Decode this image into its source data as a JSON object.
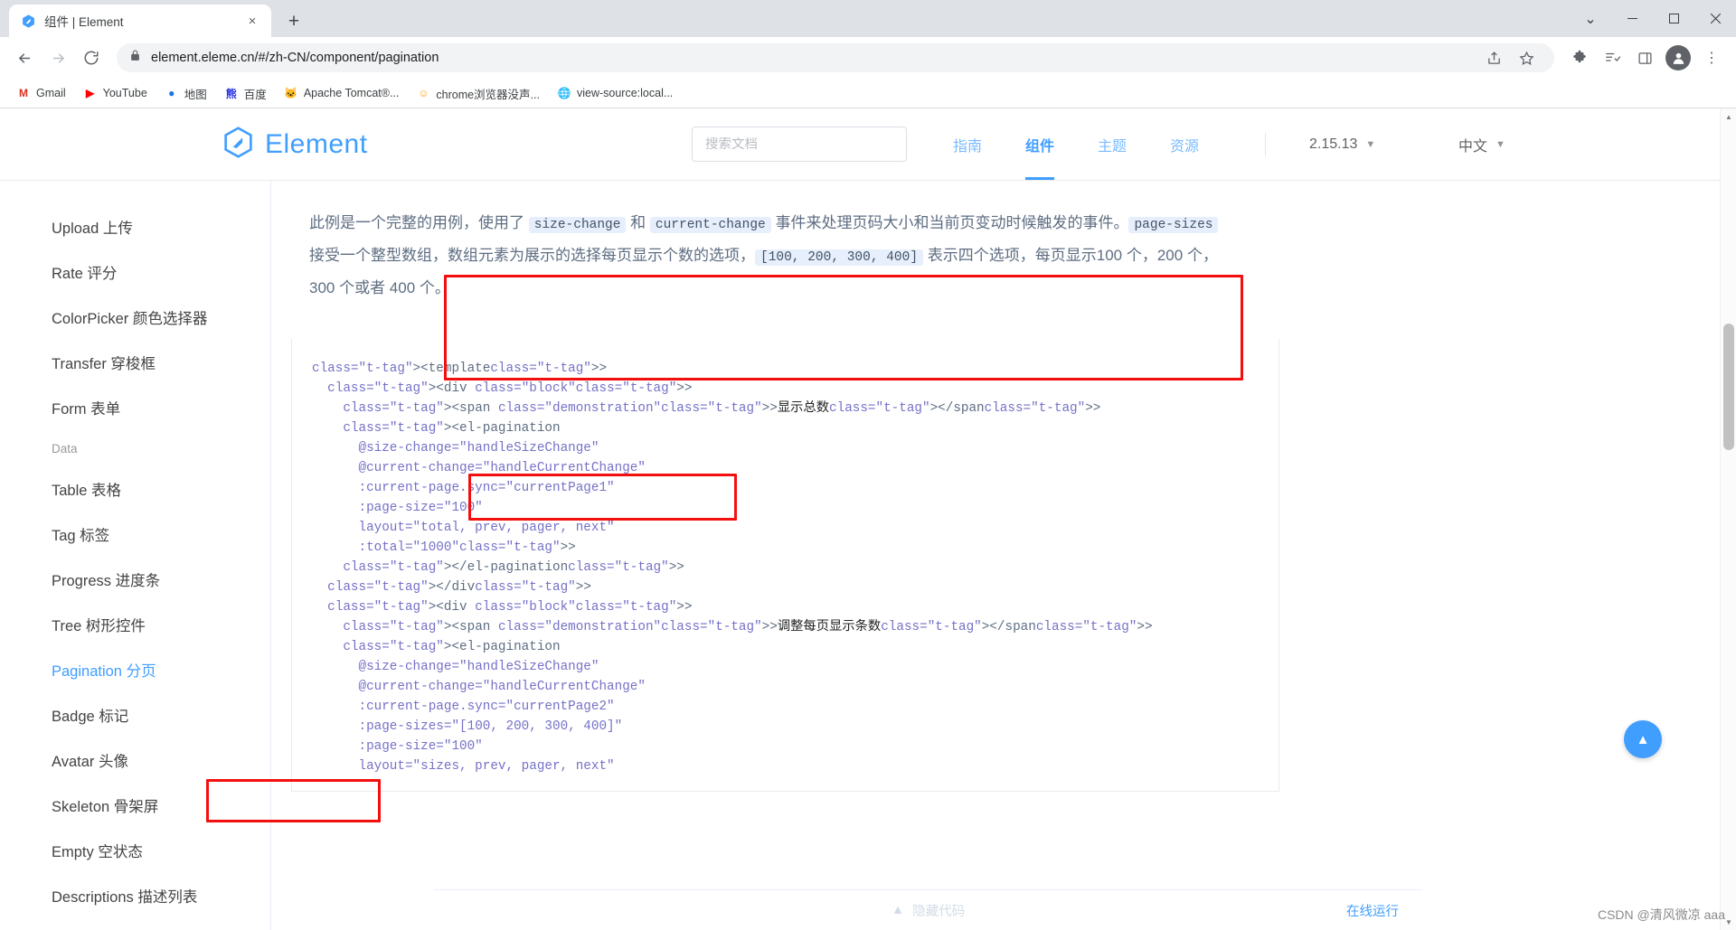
{
  "browser": {
    "tab": {
      "title": "组件 | Element",
      "favicon": "element-logo-icon",
      "close": "×"
    },
    "newtab_label": "+",
    "window_controls": {
      "minimize": "—",
      "maximize": "▢",
      "close": "✕",
      "chevron": "⌄"
    },
    "toolbar": {
      "back": "←",
      "forward": "→",
      "reload": "⟳",
      "lock": "lock-icon",
      "url": "element.eleme.cn/#/zh-CN/component/pagination",
      "share": "share-icon",
      "star": "☆",
      "extensions": "puzzle-icon",
      "readinglist": "reading-list-icon",
      "sidepanel": "side-panel-icon",
      "profile": "A",
      "menu": "⋮"
    },
    "bookmarks": [
      {
        "label": "Gmail",
        "icon": "M",
        "color": "#d93025"
      },
      {
        "label": "YouTube",
        "icon": "▶",
        "color": "#ff0000"
      },
      {
        "label": "地图",
        "icon": "●",
        "color": "#1a73e8"
      },
      {
        "label": "百度",
        "icon": "熊",
        "color": "#2932e1"
      },
      {
        "label": "Apache Tomcat®...",
        "icon": "🐱",
        "color": "#f8c471"
      },
      {
        "label": "chrome浏览器没声...",
        "icon": "☺",
        "color": "#f5a623"
      },
      {
        "label": "view-source:local...",
        "icon": "🌐",
        "color": "#5f6368"
      }
    ]
  },
  "site": {
    "brand": "Element",
    "search_placeholder": "搜索文档",
    "nav": [
      {
        "label": "指南",
        "active": false
      },
      {
        "label": "组件",
        "active": true
      },
      {
        "label": "主题",
        "active": false
      },
      {
        "label": "资源",
        "active": false
      }
    ],
    "version": "2.15.13",
    "language": "中文"
  },
  "sidebar": {
    "items": [
      {
        "label": "Upload 上传",
        "type": "item",
        "active": false
      },
      {
        "label": "Rate 评分",
        "type": "item",
        "active": false
      },
      {
        "label": "ColorPicker 颜色选择器",
        "type": "item",
        "active": false
      },
      {
        "label": "Transfer 穿梭框",
        "type": "item",
        "active": false
      },
      {
        "label": "Form 表单",
        "type": "item",
        "active": false
      },
      {
        "label": "Data",
        "type": "group"
      },
      {
        "label": "Table 表格",
        "type": "item",
        "active": false
      },
      {
        "label": "Tag 标签",
        "type": "item",
        "active": false
      },
      {
        "label": "Progress 进度条",
        "type": "item",
        "active": false
      },
      {
        "label": "Tree 树形控件",
        "type": "item",
        "active": false
      },
      {
        "label": "Pagination 分页",
        "type": "item",
        "active": true
      },
      {
        "label": "Badge 标记",
        "type": "item",
        "active": false
      },
      {
        "label": "Avatar 头像",
        "type": "item",
        "active": false
      },
      {
        "label": "Skeleton 骨架屏",
        "type": "item",
        "active": false
      },
      {
        "label": "Empty 空状态",
        "type": "item",
        "active": false
      },
      {
        "label": "Descriptions 描述列表",
        "type": "item",
        "active": false
      }
    ]
  },
  "description": {
    "line1_a": "此例是一个完整的用例，使用了 ",
    "code1": "size-change",
    "line1_b": " 和 ",
    "code2": "current-change",
    "line1_c": " 事件来处理页码大小和当前页变动时候触发的事件。",
    "code3": "page-sizes",
    "line2_b": " 接受一个整型数组，数组元素为展示的选择每页显示个数的选项，",
    "code4": "[100, 200, 300, 400]",
    "line2_c": " 表示四个选项，每页显示",
    "line3": "100 个，200 个，300 个或者 400 个。"
  },
  "code": {
    "lines": [
      "<template>",
      "  <div class=\"block\">",
      "    <span class=\"demonstration\">显示总数</span>",
      "    <el-pagination",
      "      @size-change=\"handleSizeChange\"",
      "      @current-change=\"handleCurrentChange\"",
      "      :current-page.sync=\"currentPage1\"",
      "      :page-size=\"100\"",
      "      layout=\"total, prev, pager, next\"",
      "      :total=\"1000\">",
      "    </el-pagination>",
      "  </div>",
      "  <div class=\"block\">",
      "    <span class=\"demonstration\">调整每页显示条数</span>",
      "    <el-pagination",
      "      @size-change=\"handleSizeChange\"",
      "      @current-change=\"handleCurrentChange\"",
      "      :current-page.sync=\"currentPage2\"",
      "      :page-sizes=\"[100, 200, 300, 400]\"",
      "      :page-size=\"100\"",
      "      layout=\"sizes, prev, pager, next\""
    ]
  },
  "code_footer": {
    "hide_label": "隐藏代码",
    "hide_caret": "▲",
    "run_label": "在线运行"
  },
  "back_to_top": {
    "icon": "▲"
  },
  "watermark": "CSDN @清风微凉 aaa",
  "colors": {
    "accent": "#409eff",
    "highlight": "#f40f0f",
    "code_bg": "#e6effb"
  }
}
